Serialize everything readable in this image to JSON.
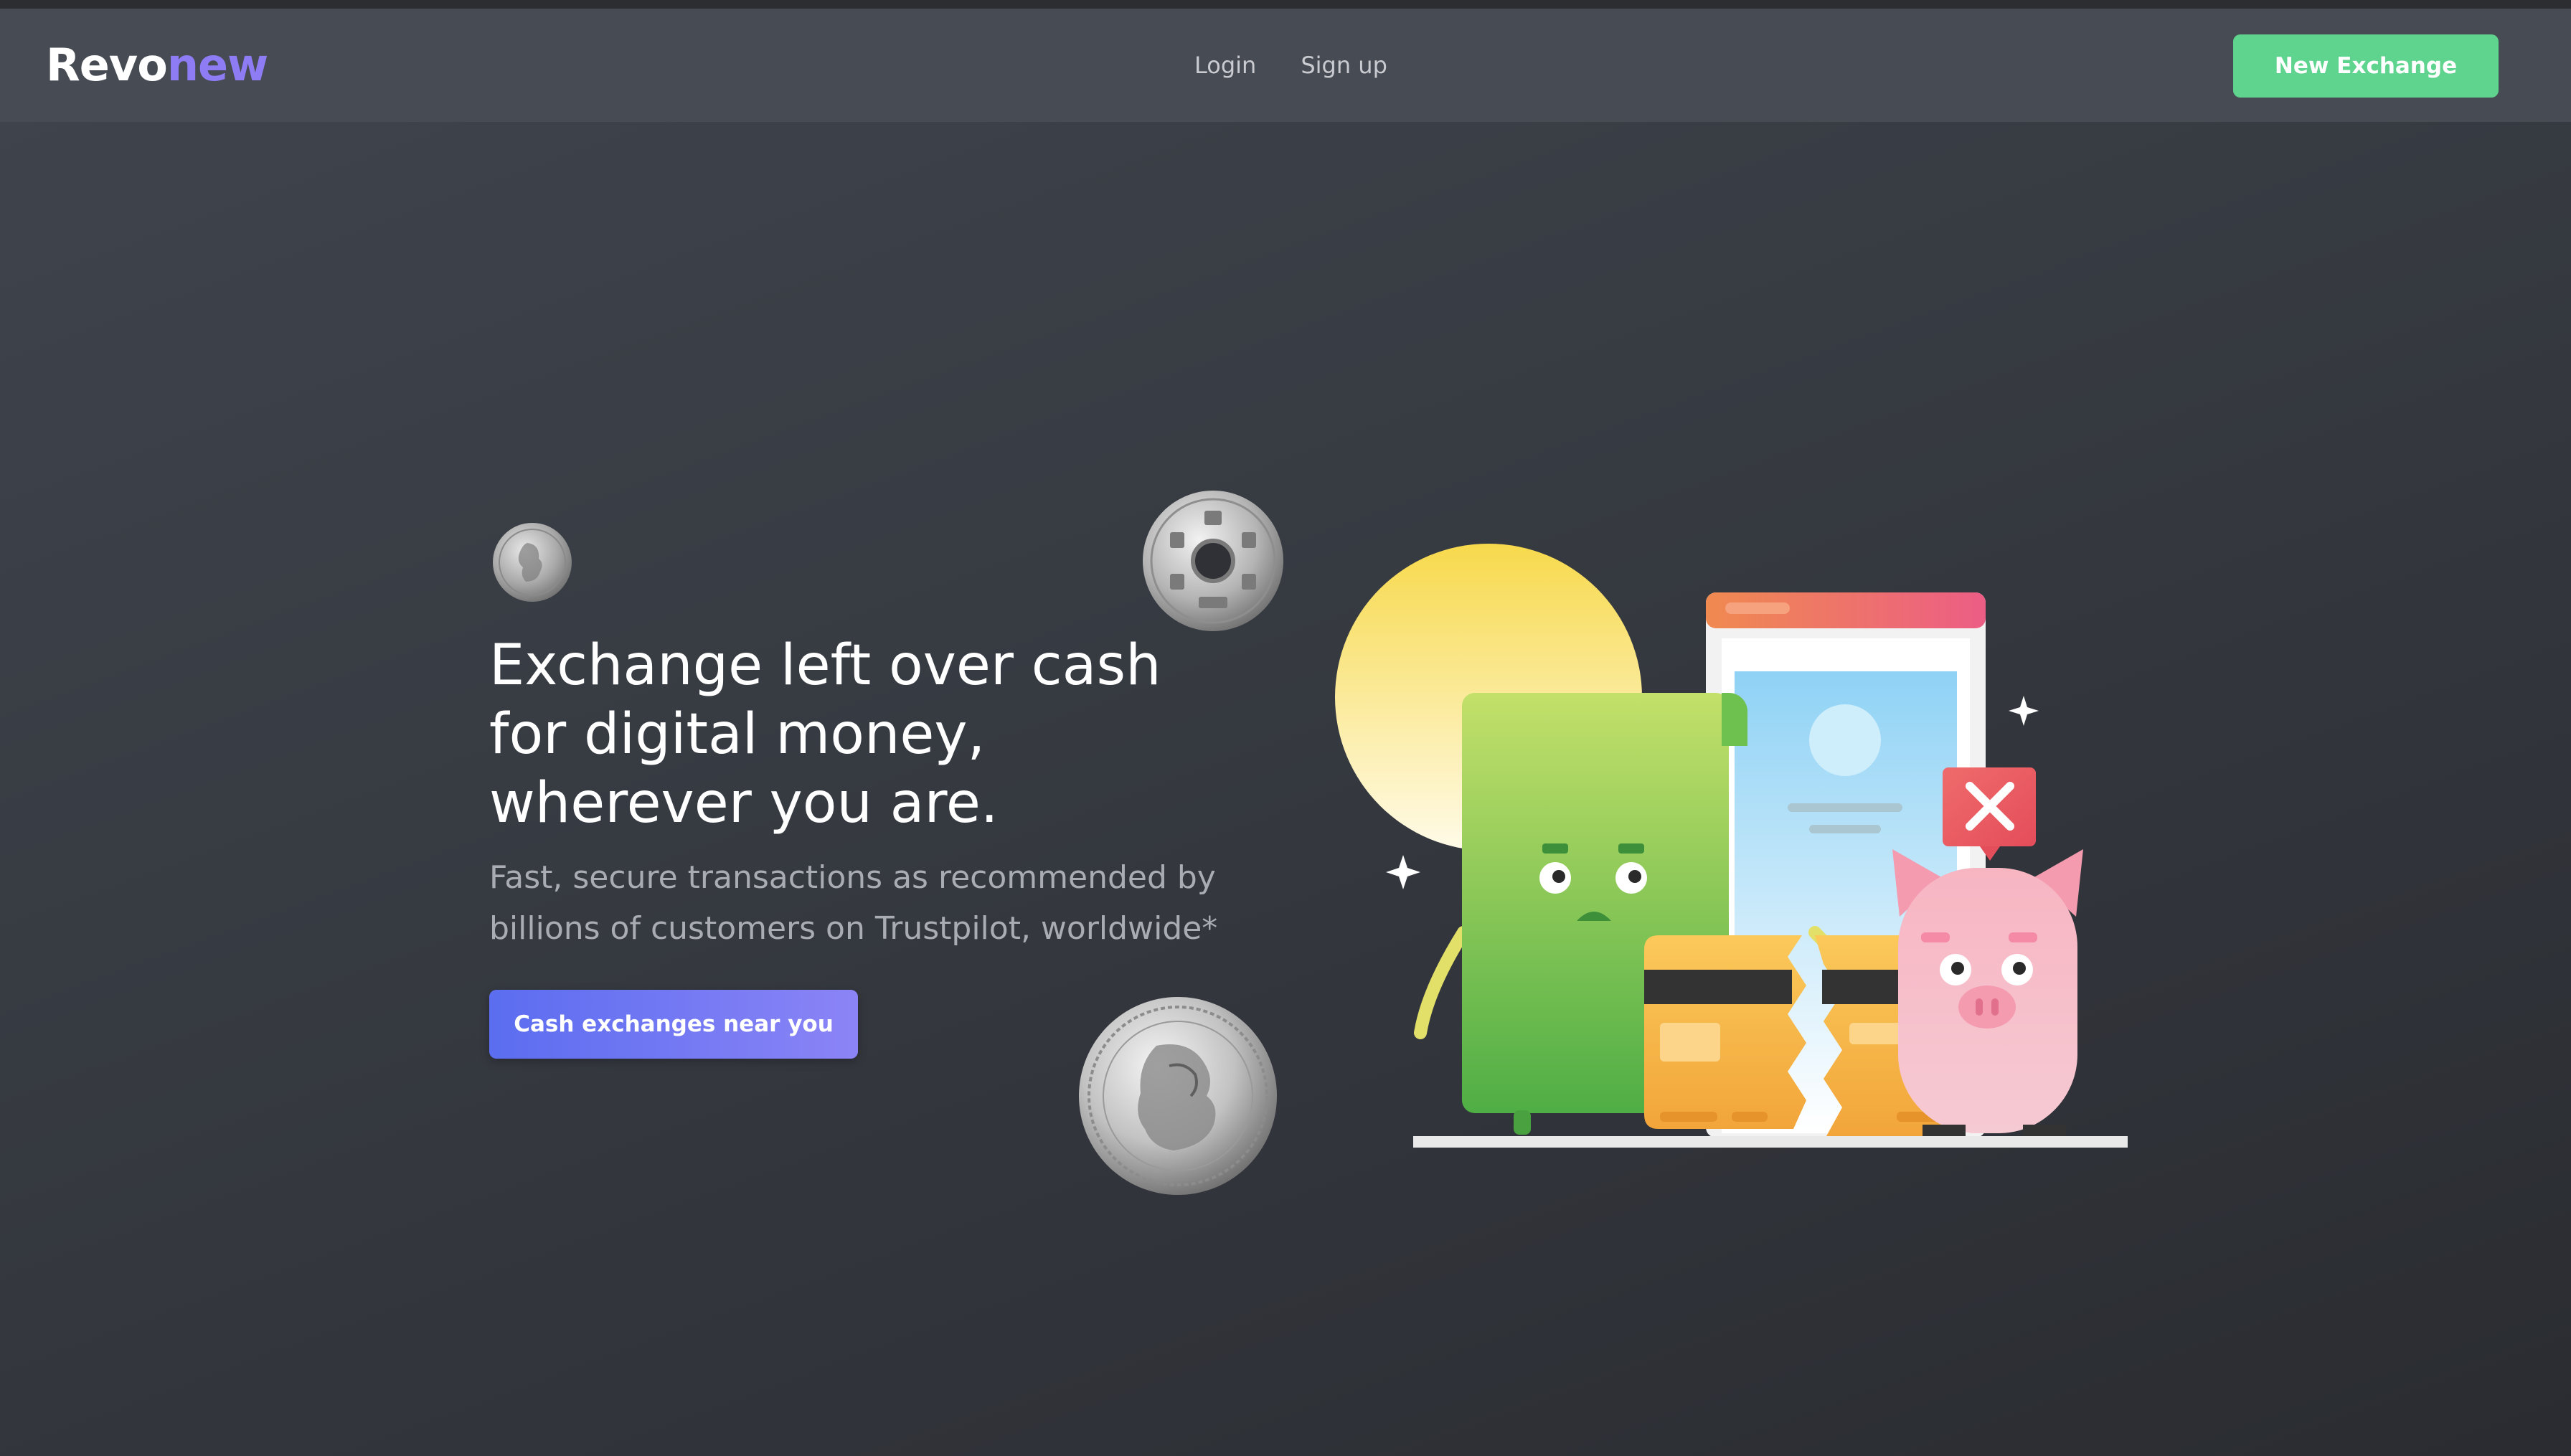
{
  "brand": {
    "logo_part1": "Revo",
    "logo_part2": "new",
    "logo_color1": "#ffffff",
    "logo_color2": "#8e7cf5"
  },
  "nav": {
    "links": [
      {
        "label": "Login"
      },
      {
        "label": "Sign up"
      }
    ],
    "cta_label": "New Exchange",
    "cta_color": "#5fd48e"
  },
  "hero": {
    "title_lines": [
      "Exchange left over cash",
      "for digital money,",
      "wherever you are."
    ],
    "subtitle_lines": [
      "Fast, secure transactions as recommended by",
      "billions of customers on Trustpilot, worldwide*"
    ],
    "button_label": "Cash exchanges near you",
    "button_color_start": "#5b6df0",
    "button_color_end": "#8b84f6"
  },
  "decor": {
    "coins": [
      "small-silver-coin-icon",
      "holed-yen-coin-icon",
      "two-pound-coin-icon"
    ],
    "illustration": "broken-card-piggy-bank-illustration"
  }
}
